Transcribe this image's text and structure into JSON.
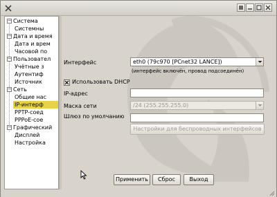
{
  "titlebar": {
    "buttons": [
      "help-button",
      "minimize-button",
      "maximize-button",
      "close-button"
    ]
  },
  "tree": {
    "items": [
      {
        "label": "Система",
        "level": 0,
        "expanded": true
      },
      {
        "label": "Системны",
        "level": 1
      },
      {
        "label": "Дата и время",
        "level": 0,
        "expanded": true
      },
      {
        "label": "Дата и врем",
        "level": 1
      },
      {
        "label": "Часовой по",
        "level": 1
      },
      {
        "label": "Пользовател",
        "level": 0,
        "expanded": true
      },
      {
        "label": "Учётные з",
        "level": 1
      },
      {
        "label": "Аутентиф",
        "level": 1
      },
      {
        "label": "Источник",
        "level": 1
      },
      {
        "label": "Сеть",
        "level": 0,
        "expanded": true
      },
      {
        "label": "Общие нас",
        "level": 1
      },
      {
        "label": "IP-интерф",
        "level": 1,
        "selected": true
      },
      {
        "label": "PPTP-соед",
        "level": 1
      },
      {
        "label": "PPPoE-сое",
        "level": 1
      },
      {
        "label": "Графический",
        "level": 0,
        "expanded": true
      },
      {
        "label": "Дисплей",
        "level": 1
      },
      {
        "label": "Настройка",
        "level": 1
      }
    ]
  },
  "form": {
    "interface_label": "Интерфейс",
    "interface_value": "eth0 (79c970 [PCnet32 LANCE])",
    "interface_hint": "(интерфейс включён, провод подсоединён)",
    "dhcp_label": "Использовать DHCP",
    "dhcp_checked": true,
    "ip_label": "IP-адрес",
    "ip_value": "",
    "mask_label": "Маска сети",
    "mask_value": "/24 (255.255.255.0)",
    "gateway_label": "Шлюз по умолчанию",
    "gateway_value": "",
    "wireless_button": "Настройки для беспроводных интерфейсов"
  },
  "actions": {
    "apply": "Применить",
    "reset": "Сброс",
    "exit": "Выход"
  },
  "colors": {
    "selection": "#e8d24a",
    "window_bg": "#d8d4cc"
  }
}
